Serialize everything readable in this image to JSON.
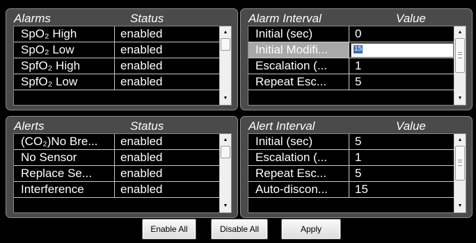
{
  "alarms": {
    "headers": [
      "Alarms",
      "Status"
    ],
    "rows": [
      [
        "SpO₂ High",
        "enabled"
      ],
      [
        "SpO₂ Low",
        "enabled"
      ],
      [
        "SpfO₂ High",
        "enabled"
      ],
      [
        "SpfO₂ Low",
        "enabled"
      ]
    ]
  },
  "alarm_interval": {
    "headers": [
      "Alarm Interval",
      "Value"
    ],
    "rows": [
      [
        "Initial (sec)",
        "0"
      ],
      [
        "Initial Modifi...",
        "15"
      ],
      [
        "Escalation (...",
        "1"
      ],
      [
        "Repeat Esc...",
        "5"
      ]
    ],
    "editing_value": "15"
  },
  "alerts": {
    "headers": [
      "Alerts",
      "Status"
    ],
    "rows": [
      [
        "(CO₂)No Bre...",
        "enabled"
      ],
      [
        "No Sensor",
        "enabled"
      ],
      [
        "Replace Se...",
        "enabled"
      ],
      [
        "Interference",
        "enabled"
      ]
    ]
  },
  "alert_interval": {
    "headers": [
      "Alert Interval",
      "Value"
    ],
    "rows": [
      [
        "Initial (sec)",
        "5"
      ],
      [
        "Escalation (...",
        "1"
      ],
      [
        "Repeat Esc...",
        "5"
      ],
      [
        "Auto-discon...",
        "15"
      ]
    ]
  },
  "buttons": {
    "enable_all": "Enable All",
    "disable_all": "Disable All",
    "apply": "Apply"
  },
  "icons": {
    "scroll_up": "scroll-up-arrow-icon",
    "scroll_down": "scroll-down-arrow-icon"
  },
  "colors": {
    "background": "#000000",
    "panel": "#4a4a4a",
    "selected_row": "#a8a8a8",
    "text_highlight": "#3a6fc0"
  }
}
